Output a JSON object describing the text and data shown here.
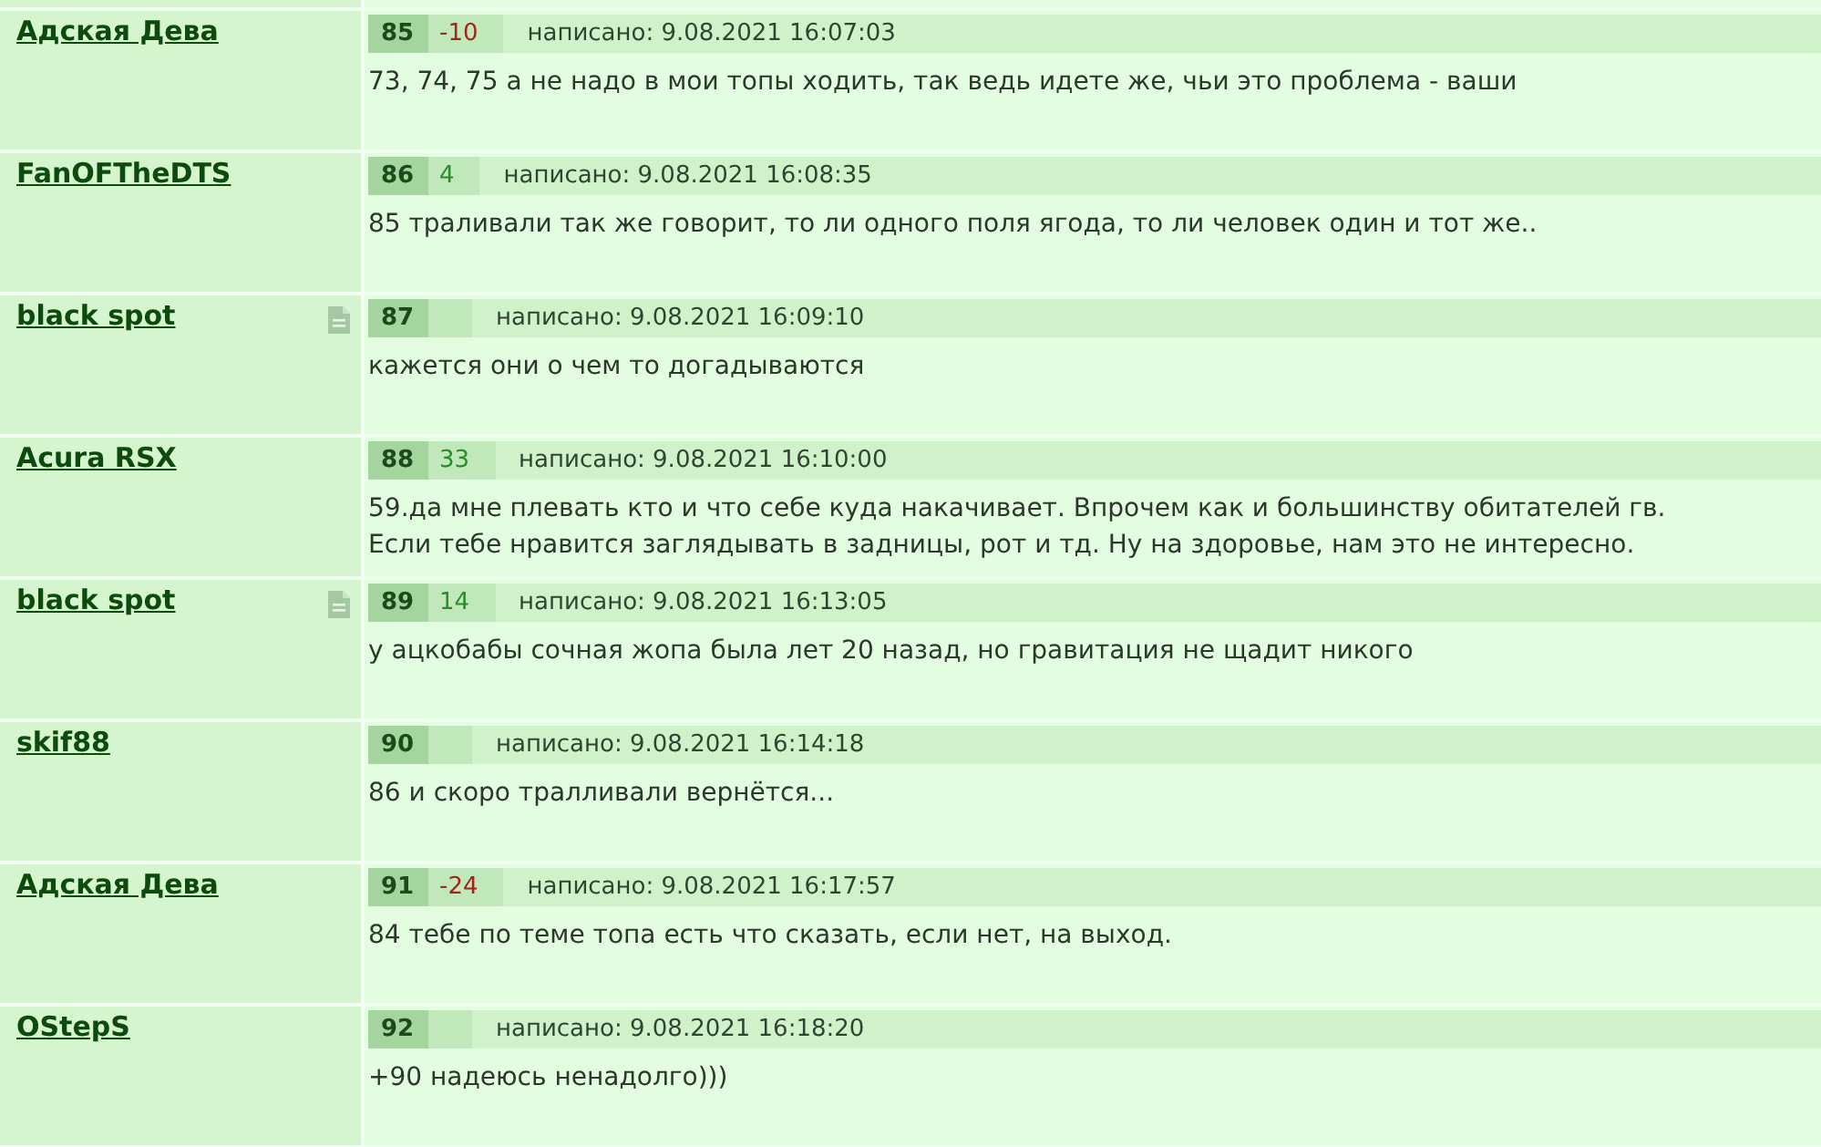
{
  "posts": [
    {
      "author": "Адская Дева",
      "note_icon": false,
      "number": "85",
      "rating": {
        "text": "-10",
        "kind": "negative"
      },
      "date": "написано: 9.08.2021 16:07:03",
      "lines": [
        "73, 74, 75 а не надо в мои топы ходить, так ведь идете же, чьи это проблема - ваши"
      ]
    },
    {
      "author": "FanOFTheDTS",
      "note_icon": false,
      "number": "86",
      "rating": {
        "text": "4",
        "kind": "positive"
      },
      "date": "написано: 9.08.2021 16:08:35",
      "lines": [
        "85 траливали так же говорит, то ли одного поля ягода, то ли человек один и тот же.."
      ]
    },
    {
      "author": "black spot",
      "note_icon": true,
      "number": "87",
      "date": "написано: 9.08.2021 16:09:10",
      "lines": [
        "кажется они о чем то догадываются"
      ]
    },
    {
      "author": "Acura RSX",
      "note_icon": false,
      "number": "88",
      "rating": {
        "text": "33",
        "kind": "positive"
      },
      "date": "написано: 9.08.2021 16:10:00",
      "lines": [
        "59.да мне плевать кто и что себе куда накачивает. Впрочем как и большинству обитателей гв.",
        "Если тебе нравится заглядывать в задницы, рот и тд. Ну на здоровье, нам это не интересно."
      ]
    },
    {
      "author": "black spot",
      "note_icon": true,
      "number": "89",
      "rating": {
        "text": "14",
        "kind": "positive"
      },
      "date": "написано: 9.08.2021 16:13:05",
      "lines": [
        "у ацкобабы сочная жопа была лет 20 назад, но гравитация не щадит никого"
      ]
    },
    {
      "author": "skif88",
      "note_icon": false,
      "number": "90",
      "date": "написано: 9.08.2021 16:14:18",
      "lines": [
        "86 и скоро тралливали вернётся..."
      ]
    },
    {
      "author": "Адская Дева",
      "note_icon": false,
      "number": "91",
      "rating": {
        "text": "-24",
        "kind": "negative"
      },
      "date": "написано: 9.08.2021 16:17:57",
      "lines": [
        "84 тебе по теме топа есть что сказать, если нет, на выход."
      ]
    },
    {
      "author": "OStepS",
      "note_icon": false,
      "number": "92",
      "date": "написано: 9.08.2021 16:18:20",
      "lines": [
        "+90 надеюсь ненадолго)))"
      ]
    }
  ]
}
